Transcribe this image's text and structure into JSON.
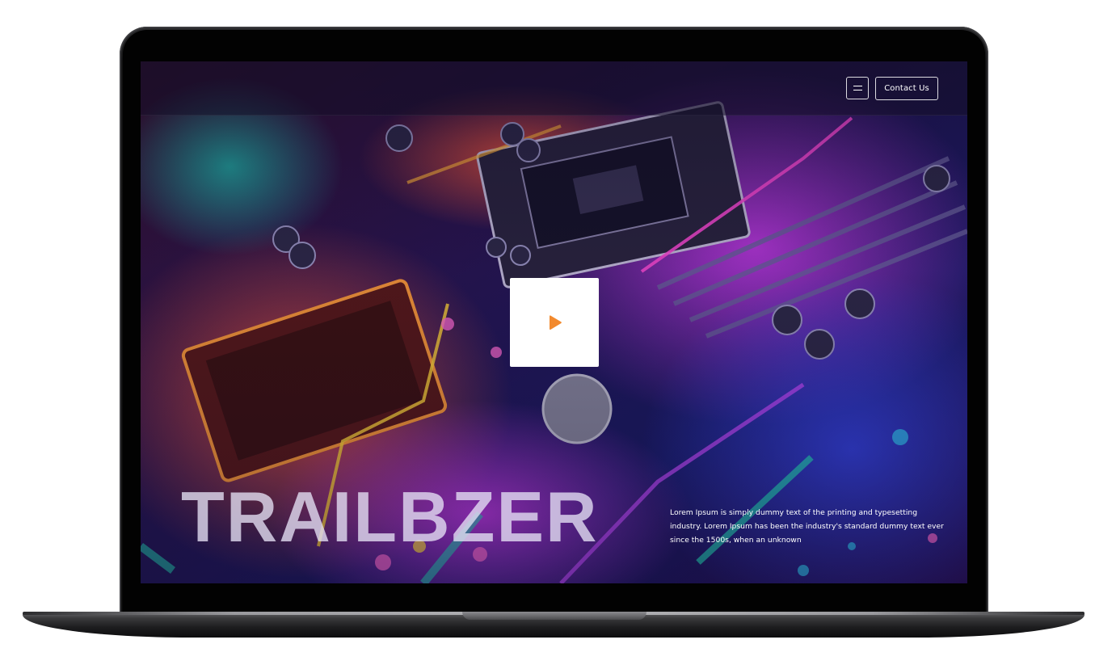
{
  "header": {
    "menu_icon": "hamburger-menu-icon",
    "contact_label": "Contact Us"
  },
  "hero": {
    "title": "TRAILBZER",
    "description": "Lorem Ipsum is simply dummy text of the printing and typesetting industry. Lorem Ipsum has been the industry's standard dummy text ever since the 1500s, when an unknown",
    "play_icon": "play-icon"
  },
  "colors": {
    "accent": "#F28A2E",
    "play_box": "#FFFFFF",
    "text": "#FFFFFF",
    "header_bg": "#140E28"
  }
}
